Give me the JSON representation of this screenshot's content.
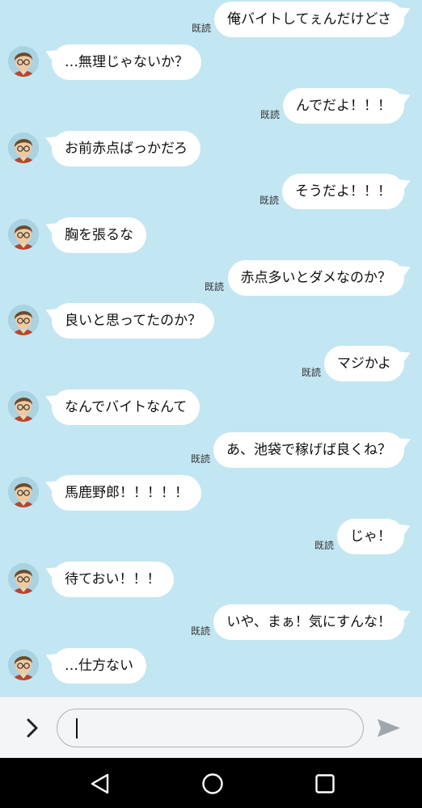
{
  "read_label": "既読",
  "messages": [
    {
      "side": "me",
      "text": "俺バイトしてぇんだけどさ",
      "read": true
    },
    {
      "side": "them",
      "text": "…無理じゃないか？"
    },
    {
      "side": "me",
      "text": "んでだよ！！！",
      "read": true
    },
    {
      "side": "them",
      "text": "お前赤点ばっかだろ"
    },
    {
      "side": "me",
      "text": "そうだよ！！！",
      "read": true
    },
    {
      "side": "them",
      "text": "胸を張るな"
    },
    {
      "side": "me",
      "text": "赤点多いとダメなのか？",
      "read": true
    },
    {
      "side": "them",
      "text": "良いと思ってたのか？"
    },
    {
      "side": "me",
      "text": "マジかよ",
      "read": true
    },
    {
      "side": "them",
      "text": "なんでバイトなんて"
    },
    {
      "side": "me",
      "text": "あ、池袋で稼げば良くね？",
      "read": true
    },
    {
      "side": "them",
      "text": "馬鹿野郎！！！！！"
    },
    {
      "side": "me",
      "text": "じゃ！",
      "read": true
    },
    {
      "side": "them",
      "text": "待ておい！！！"
    },
    {
      "side": "me",
      "text": "いや、まぁ！気にすんな！",
      "read": true
    },
    {
      "side": "them",
      "text": "…仕方ない"
    }
  ],
  "input": {
    "value": "",
    "placeholder": ""
  },
  "icons": {
    "expand": "chevron-right-icon",
    "send": "send-icon",
    "nav_back": "triangle-back-icon",
    "nav_home": "circle-home-icon",
    "nav_recents": "square-recents-icon"
  },
  "colors": {
    "chat_background": "#c3e6f3",
    "bubble": "#ffffff",
    "input_bar": "#f4f5f6",
    "nav_bar": "#000000"
  }
}
